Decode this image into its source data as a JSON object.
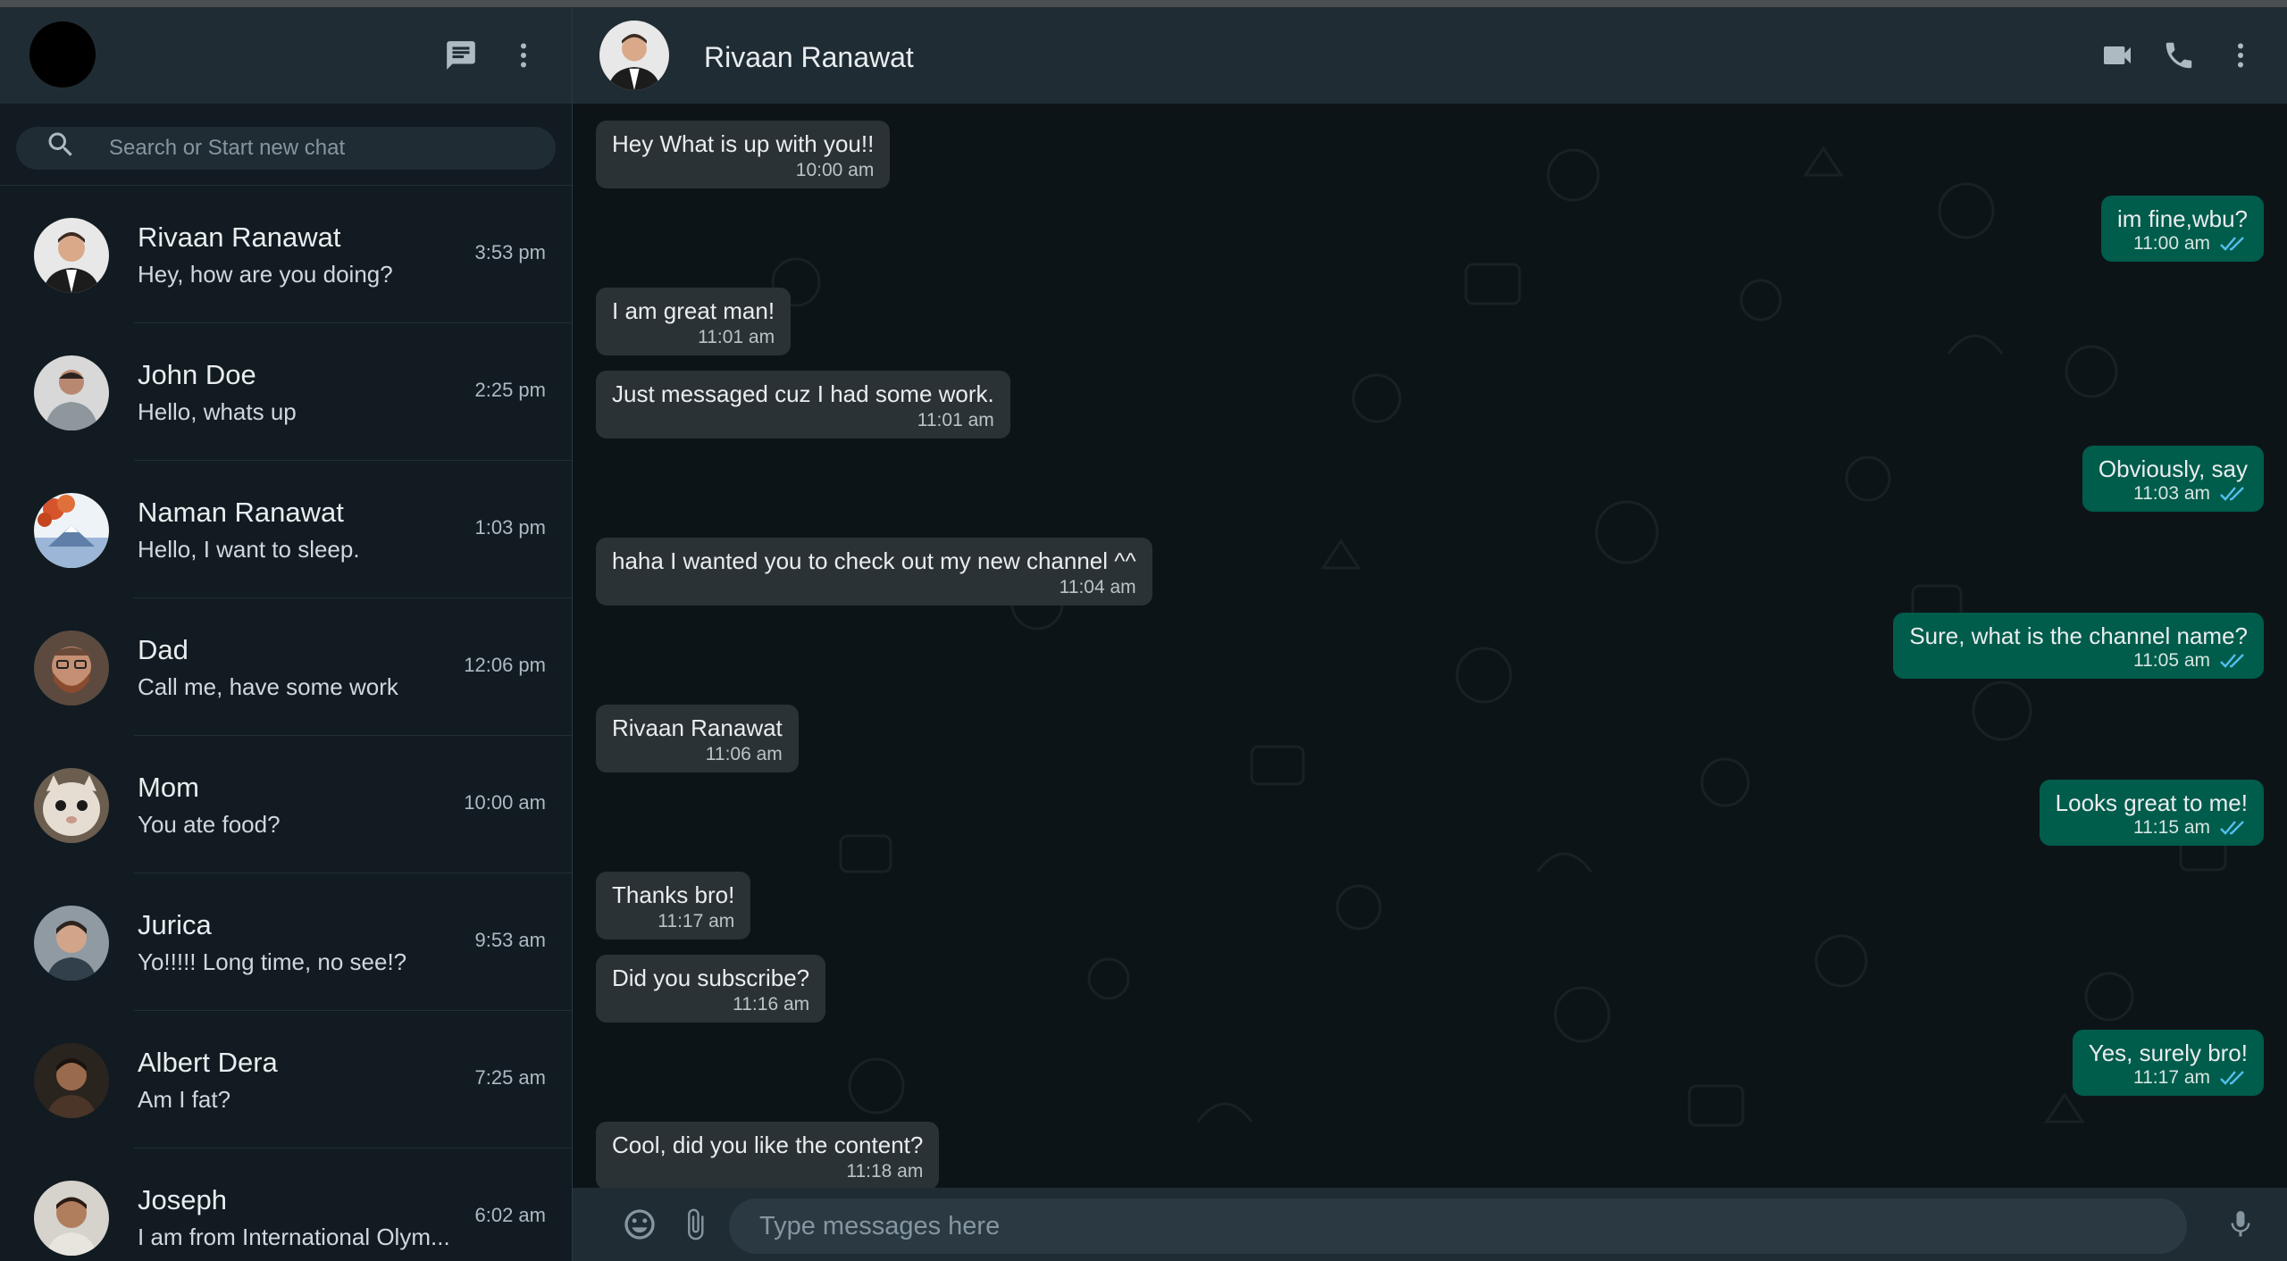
{
  "sidebar": {
    "search": {
      "placeholder": "Search or Start new chat"
    },
    "chats": [
      {
        "name": "Rivaan Ranawat",
        "preview": "Hey, how are you doing?",
        "time": "3:53 pm"
      },
      {
        "name": "John Doe",
        "preview": "Hello, whats up",
        "time": "2:25 pm"
      },
      {
        "name": "Naman Ranawat",
        "preview": "Hello, I want to sleep.",
        "time": "1:03 pm"
      },
      {
        "name": "Dad",
        "preview": "Call me, have some work",
        "time": "12:06 pm"
      },
      {
        "name": "Mom",
        "preview": "You ate food?",
        "time": "10:00 am"
      },
      {
        "name": "Jurica",
        "preview": "Yo!!!!! Long time, no see!?",
        "time": "9:53 am"
      },
      {
        "name": "Albert Dera",
        "preview": "Am I fat?",
        "time": "7:25 am"
      },
      {
        "name": "Joseph",
        "preview": "I am from International Olym...",
        "time": "6:02 am"
      }
    ]
  },
  "conversation": {
    "contact_name": "Rivaan Ranawat",
    "messages": [
      {
        "text": "Hey What is up with you!!",
        "time": "10:00 am"
      },
      {
        "text": "im fine,wbu?",
        "time": "11:00 am"
      },
      {
        "text": "I am great man!",
        "time": "11:01 am"
      },
      {
        "text": "Just messaged cuz I had some work.",
        "time": "11:01 am"
      },
      {
        "text": "Obviously, say",
        "time": "11:03 am"
      },
      {
        "text": "haha I wanted you to check out my new channel ^^",
        "time": "11:04 am"
      },
      {
        "text": "Sure, what is the channel name?",
        "time": "11:05 am"
      },
      {
        "text": "Rivaan Ranawat",
        "time": "11:06 am"
      },
      {
        "text": "Looks great to me!",
        "time": "11:15 am"
      },
      {
        "text": "Thanks bro!",
        "time": "11:17 am"
      },
      {
        "text": "Did you subscribe?",
        "time": "11:16 am"
      },
      {
        "text": "Yes, surely bro!",
        "time": "11:17 am"
      },
      {
        "text": "Cool, did you like the content?",
        "time": "11:18 am"
      }
    ]
  },
  "composer": {
    "placeholder": "Type messages here"
  },
  "colors": {
    "panel": "#202c33",
    "sidebar_bg": "#111b21",
    "incoming_bubble": "#2a3236",
    "outgoing_bubble": "#005c4b",
    "read_ticks": "#53bdeb"
  }
}
